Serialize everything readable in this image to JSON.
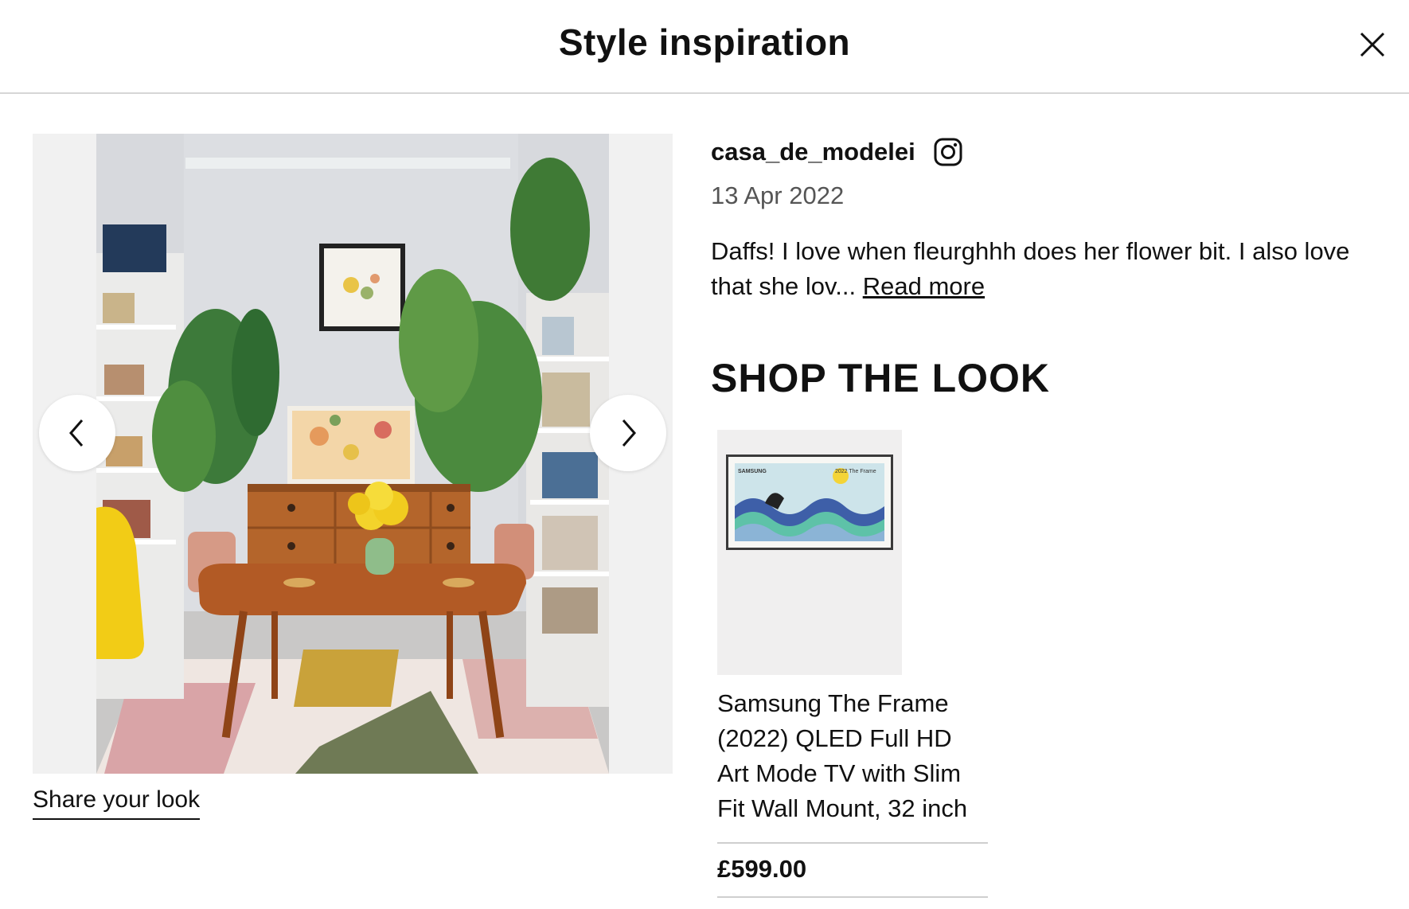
{
  "header": {
    "title": "Style inspiration",
    "close_icon": "close-icon"
  },
  "gallery": {
    "prev_icon": "chevron-left-icon",
    "next_icon": "chevron-right-icon",
    "share_label": "Share your look"
  },
  "post": {
    "username": "casa_de_modelei",
    "platform_icon": "instagram-icon",
    "date": "13 Apr 2022",
    "caption": "Daffs! I love when fleurghhh does her flower bit. I also love that she lov...",
    "read_more_label": "Read more"
  },
  "shop": {
    "title": "SHOP THE LOOK",
    "products": [
      {
        "name": "Samsung The Frame (2022) QLED Full HD Art Mode TV with Slim Fit Wall Mount, 32 inch",
        "price": "£599.00",
        "thumb_brand": "SAMSUNG",
        "thumb_label": "2022 The Frame"
      }
    ]
  },
  "colors": {
    "text": "#111111",
    "muted": "#555555",
    "divider": "#d6d6d6",
    "gallery_bg": "#f1f1f1",
    "thumb_bg": "#f0efef"
  }
}
